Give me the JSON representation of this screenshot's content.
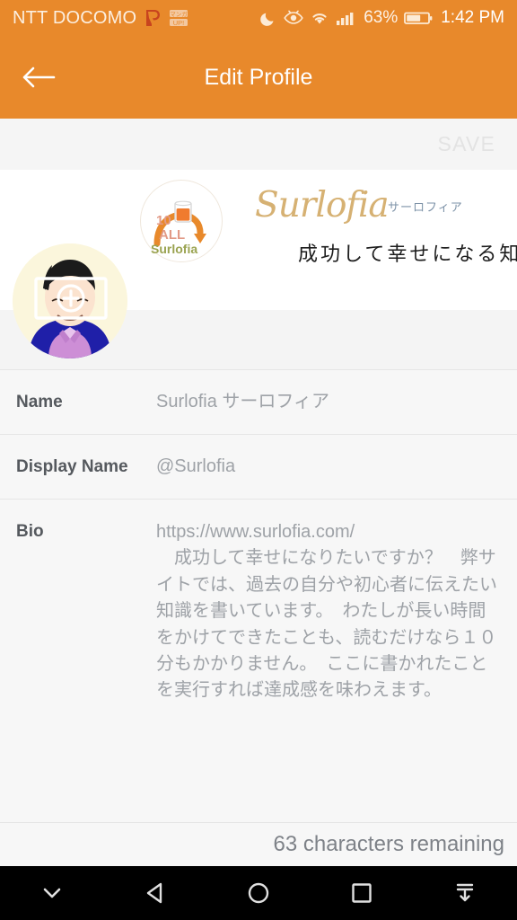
{
  "status_bar": {
    "carrier": "NTT DOCOMO",
    "app_icons": [
      "paypay-icon",
      "manga-up-icon"
    ],
    "icons": [
      "moon-icon",
      "eye-comfort-icon",
      "wifi-icon",
      "signal-icon"
    ],
    "battery_percent": "63%",
    "time": "1:42 PM",
    "background_color": "#E8892B"
  },
  "app_bar": {
    "back_icon": "arrow-left-icon",
    "title": "Edit Profile",
    "background_color": "#E8892B"
  },
  "save_bar": {
    "save_label": "SAVE",
    "disabled_color": "#E3E3E3"
  },
  "banner": {
    "badge": {
      "line1": "10",
      "line2": "ALL",
      "line3": "Surlofia",
      "arch_color": "#E8892B",
      "text_color": "#E29A86",
      "name_color": "#9AA350"
    },
    "wordmark": "Surlofia",
    "wordmark_color": "#D6B173",
    "katakana": "サーロフィア",
    "katakana_color": "#7E93A8",
    "tagline": "成功して幸せになる知識"
  },
  "avatar": {
    "alt": "profile-avatar",
    "overlay_icon": "camera-photo-icon"
  },
  "form": {
    "rows": [
      {
        "label": "Name",
        "value": "Surlofia サーロフィア"
      },
      {
        "label": "Display Name",
        "value": "@Surlofia"
      }
    ],
    "bio": {
      "label": "Bio",
      "value": "https://www.surlofia.com/\n　成功して幸せになりたいですか？　弊サイトでは、過去の自分や初心者に伝えたい知識を書いています。　わたしが長い時間をかけてできたことも、読むだけなら１０分もかかりません。　ここに書かれたことを実行すれば達成感を味わえます。"
    }
  },
  "counter": {
    "text": "63 characters remaining"
  },
  "nav_bar": {
    "buttons": [
      "hide-keyboard-icon",
      "back-icon",
      "home-icon",
      "recents-icon",
      "collapse-nav-icon"
    ]
  }
}
